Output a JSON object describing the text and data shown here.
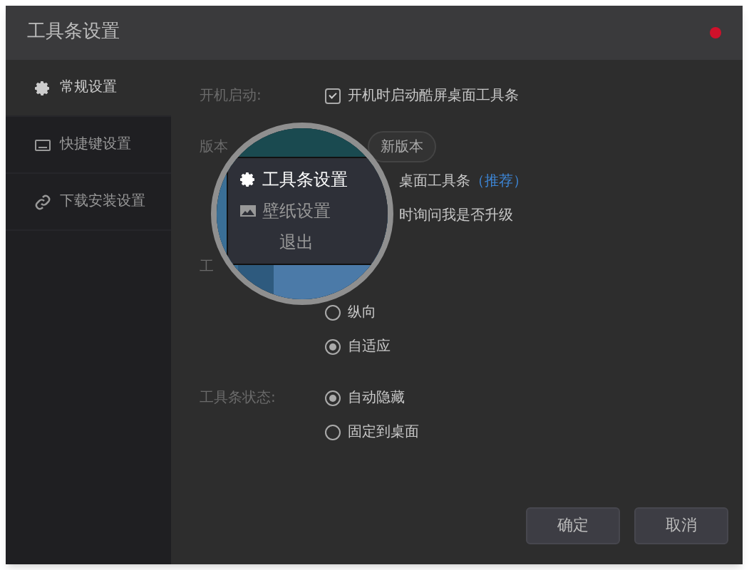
{
  "window": {
    "title": "工具条设置"
  },
  "sidebar": {
    "items": [
      {
        "label": "常规设置",
        "selected": true
      },
      {
        "label": "快捷键设置",
        "selected": false
      },
      {
        "label": "下载安装设置",
        "selected": false
      }
    ]
  },
  "settings": [
    {
      "kind": "checkbox",
      "label": "开机启动:",
      "text": "开机时启动酷屏桌面工具条",
      "checked": true
    },
    {
      "kind": "button",
      "label": "版本",
      "text": "新版本"
    },
    {
      "kind": "text",
      "text": "桌面工具条",
      "link": "（推荐）"
    },
    {
      "kind": "text",
      "text": "时询问我是否升级"
    },
    {
      "kind": "label",
      "label": "工"
    },
    {
      "kind": "radio",
      "text": "纵向",
      "selected": false
    },
    {
      "kind": "radio",
      "text": "自适应",
      "selected": true
    },
    {
      "kind": "radio",
      "label": "工具条状态:",
      "text": "自动隐藏",
      "selected": true
    },
    {
      "kind": "radio",
      "text": "固定到桌面",
      "selected": false
    }
  ],
  "magnifier": {
    "menu": [
      {
        "label": "工具条设置",
        "highlighted": true
      },
      {
        "label": "壁纸设置",
        "highlighted": false
      },
      {
        "label": "退出",
        "highlighted": false
      }
    ]
  },
  "buttons": [
    "确定",
    "取消"
  ]
}
